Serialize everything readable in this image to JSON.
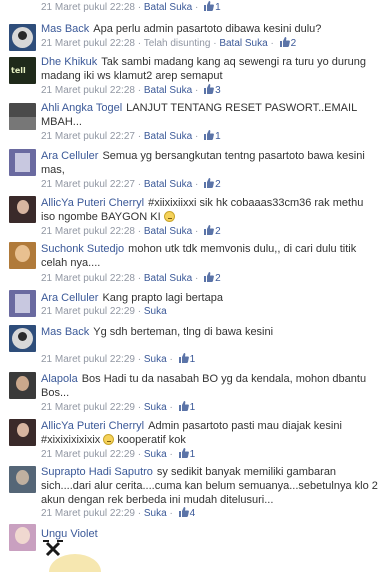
{
  "comments": [
    {
      "author": "",
      "text": "",
      "time": "21 Maret pukul 22:28",
      "action": "Batal Suka",
      "edited": "",
      "likes": "1",
      "avatar_color": "#888888"
    },
    {
      "author": "Mas Back",
      "text": "Apa perlu admin pasartoto dibawa kesini dulu?",
      "time": "21 Maret pukul 22:28",
      "action": "Batal Suka",
      "edited": "Telah disunting",
      "likes": "2",
      "avatar_color": "#2e4d7a"
    },
    {
      "author": "Dhe Khikuk",
      "text": "Tak sambi madang kang aq sewengi ra turu yo durung madang iki ws klamut2 arep semaput",
      "time": "21 Maret pukul 22:28",
      "action": "Batal Suka",
      "edited": "",
      "likes": "3",
      "avatar_color": "#1f2a1a"
    },
    {
      "author": "Ahli Angka Togel",
      "text": "LANJUT TENTANG RESET PASWORT..EMAIL MBAH...",
      "time": "21 Maret pukul 22:27",
      "action": "Batal Suka",
      "edited": "",
      "likes": "1",
      "avatar_color": "#4a4a4a"
    },
    {
      "author": "Ara Celluler",
      "text": "Semua yg bersangkutan tentng pasartoto bawa kesini mas,",
      "time": "21 Maret pukul 22:27",
      "action": "Batal Suka",
      "edited": "",
      "likes": "2",
      "avatar_color": "#6a6aa0"
    },
    {
      "author": "AllicYa Puteri Cherryl",
      "text": "#xiixixiixxi sik hk cobaaas33cm36 rak methu iso ngombe BAYGON KI",
      "time": "21 Maret pukul 22:28",
      "action": "Batal Suka",
      "edited": "",
      "likes": "2",
      "avatar_color": "#3a2a2a"
    },
    {
      "author": "Suchonk Sutedjo",
      "text": "mohon utk tdk memvonis dulu,, di cari dulu titik celah nya....",
      "time": "21 Maret pukul 22:28",
      "action": "Batal Suka",
      "edited": "",
      "likes": "2",
      "avatar_color": "#b07a3a"
    },
    {
      "author": "Ara Celluler",
      "text": "Kang prapto lagi bertapa",
      "time": "21 Maret pukul 22:29",
      "action": "Suka",
      "edited": "",
      "likes": "",
      "avatar_color": "#6a6aa0"
    },
    {
      "author": "Mas Back",
      "text": "Yg sdh berteman, tlng di bawa kesini",
      "time": "21 Maret pukul 22:29",
      "action": "Suka",
      "edited": "",
      "likes": "1",
      "avatar_color": "#2e4d7a"
    },
    {
      "author": "Alapola",
      "text": "Bos Hadi tu da nasabah BO yg da kendala, mohon dbantu Bos...",
      "time": "21 Maret pukul 22:29",
      "action": "Suka",
      "edited": "",
      "likes": "1",
      "avatar_color": "#3a3a3a"
    },
    {
      "author": "AllicYa Puteri Cherryl",
      "text": "Admin pasartoto pasti mau diajak kesini #xixixixixixix",
      "text2": "kooperatif kok",
      "time": "21 Maret pukul 22:29",
      "action": "Suka",
      "edited": "",
      "likes": "1",
      "avatar_color": "#3a2a2a"
    },
    {
      "author": "Suprapto Hadi Saputro",
      "text": "sy sedikit banyak memiliki gambaran sich....dari alur cerita....cuma kan belum semuanya...sebetulnya klo 2 akun dengan rek berbeda ini mudah ditelusuri...",
      "time": "21 Maret pukul 22:29",
      "action": "Suka",
      "edited": "",
      "likes": "4",
      "avatar_color": "#556677"
    },
    {
      "author": "Ungu Violet",
      "text": "",
      "time": "",
      "action": "",
      "edited": "",
      "likes": "",
      "avatar_color": "#c9a0c0"
    }
  ],
  "separator": "·",
  "colors": {
    "link": "#3b5998",
    "meta": "#9197a3",
    "text": "#333333"
  },
  "icons": {
    "like": "thumbs-up-icon",
    "emoji": "smiley-emoji-icon",
    "sticker": "sticker-icon"
  }
}
